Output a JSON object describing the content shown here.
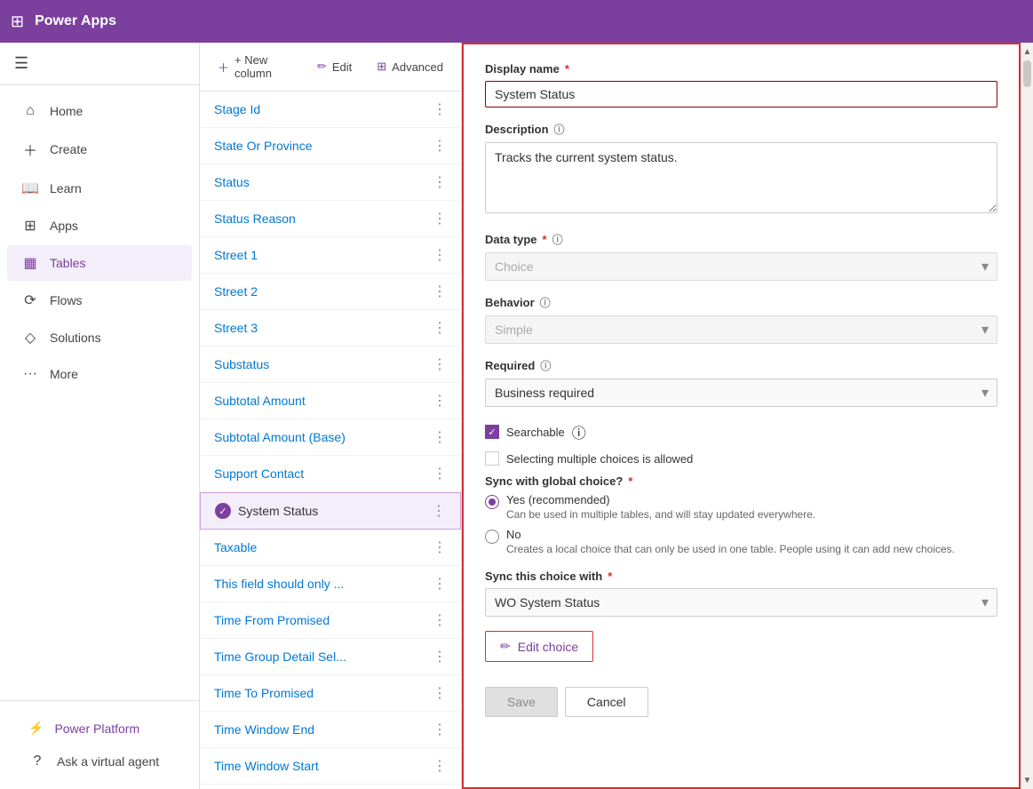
{
  "topbar": {
    "title": "Power Apps",
    "grid_icon": "⊞"
  },
  "sidebar": {
    "hamburger": "☰",
    "items": [
      {
        "id": "home",
        "label": "Home",
        "icon": "⌂"
      },
      {
        "id": "create",
        "label": "Create",
        "icon": "+"
      },
      {
        "id": "learn",
        "label": "Learn",
        "icon": "□"
      },
      {
        "id": "apps",
        "label": "Apps",
        "icon": "⊞"
      },
      {
        "id": "tables",
        "label": "Tables",
        "icon": "▦",
        "active": true
      },
      {
        "id": "flows",
        "label": "Flows",
        "icon": "⟳"
      },
      {
        "id": "solutions",
        "label": "Solutions",
        "icon": "◇"
      },
      {
        "id": "more",
        "label": "More",
        "icon": "···"
      }
    ],
    "bottom": {
      "ask_agent": "Ask a virtual agent",
      "power_platform": "Power Platform"
    }
  },
  "toolbar": {
    "new_column": "+ New column",
    "edit": "Edit",
    "advanced": "Advanced"
  },
  "list": {
    "items": [
      {
        "id": "stage-id",
        "name": "Stage Id",
        "selected": false
      },
      {
        "id": "state-or-province",
        "name": "State Or Province",
        "selected": false
      },
      {
        "id": "status",
        "name": "Status",
        "selected": false
      },
      {
        "id": "status-reason",
        "name": "Status Reason",
        "selected": false
      },
      {
        "id": "street-1",
        "name": "Street 1",
        "selected": false
      },
      {
        "id": "street-2",
        "name": "Street 2",
        "selected": false
      },
      {
        "id": "street-3",
        "name": "Street 3",
        "selected": false
      },
      {
        "id": "substatus",
        "name": "Substatus",
        "selected": false
      },
      {
        "id": "subtotal-amount",
        "name": "Subtotal Amount",
        "selected": false
      },
      {
        "id": "subtotal-amount-base",
        "name": "Subtotal Amount (Base)",
        "selected": false
      },
      {
        "id": "support-contact",
        "name": "Support Contact",
        "selected": false
      },
      {
        "id": "system-status",
        "name": "System Status",
        "selected": true
      },
      {
        "id": "taxable",
        "name": "Taxable",
        "selected": false
      },
      {
        "id": "this-field",
        "name": "This field should only ...",
        "selected": false
      },
      {
        "id": "time-from-promised",
        "name": "Time From Promised",
        "selected": false
      },
      {
        "id": "time-group-detail",
        "name": "Time Group Detail Sel...",
        "selected": false
      },
      {
        "id": "time-to-promised",
        "name": "Time To Promised",
        "selected": false
      },
      {
        "id": "time-window-end",
        "name": "Time Window End",
        "selected": false
      },
      {
        "id": "time-window-start",
        "name": "Time Window Start",
        "selected": false
      }
    ]
  },
  "edit_panel": {
    "display_name_label": "Display name",
    "display_name_required": "*",
    "display_name_value": "System Status",
    "description_label": "Description",
    "description_value": "Tracks the current system status.",
    "data_type_label": "Data type",
    "data_type_required": "*",
    "data_type_value": "Choice",
    "behavior_label": "Behavior",
    "behavior_value": "Simple",
    "required_label": "Required",
    "required_value": "Business required",
    "searchable_label": "Searchable",
    "searchable_checked": true,
    "multiple_choices_label": "Selecting multiple choices is allowed",
    "multiple_choices_checked": false,
    "sync_global_label": "Sync with global choice?",
    "sync_global_required": "*",
    "yes_label": "Yes (recommended)",
    "yes_desc": "Can be used in multiple tables, and will stay updated everywhere.",
    "no_label": "No",
    "no_desc": "Creates a local choice that can only be used in one table. People using it can add new choices.",
    "sync_this_label": "Sync this choice with",
    "sync_this_required": "*",
    "sync_this_value": "WO System Status",
    "edit_choice_label": "Edit choice",
    "save_label": "Save",
    "cancel_label": "Cancel"
  }
}
